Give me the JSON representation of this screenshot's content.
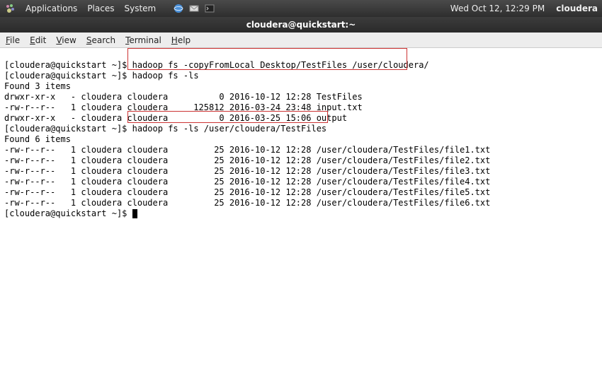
{
  "top_panel": {
    "menu": [
      "Applications",
      "Places",
      "System"
    ],
    "datetime": "Wed Oct 12, 12:29 PM",
    "user": "cloudera"
  },
  "window": {
    "title": "cloudera@quickstart:~"
  },
  "menubar": [
    "File",
    "Edit",
    "View",
    "Search",
    "Terminal",
    "Help"
  ],
  "terminal": {
    "prompt": "[cloudera@quickstart ~]$ ",
    "cmds": {
      "c1": "hadoop fs -copyFromLocal Desktop/TestFiles /user/cloudera/",
      "c2": "hadoop fs -ls",
      "c3": "hadoop fs -ls /user/cloudera/TestFiles"
    },
    "found3": "Found 3 items",
    "found6": "Found 6 items",
    "ls1": [
      "drwxr-xr-x   - cloudera cloudera          0 2016-10-12 12:28 TestFiles",
      "-rw-r--r--   1 cloudera cloudera     125812 2016-03-24 23:48 input.txt",
      "drwxr-xr-x   - cloudera cloudera          0 2016-03-25 15:06 output"
    ],
    "ls2": [
      "-rw-r--r--   1 cloudera cloudera         25 2016-10-12 12:28 /user/cloudera/TestFiles/file1.txt",
      "-rw-r--r--   1 cloudera cloudera         25 2016-10-12 12:28 /user/cloudera/TestFiles/file2.txt",
      "-rw-r--r--   1 cloudera cloudera         25 2016-10-12 12:28 /user/cloudera/TestFiles/file3.txt",
      "-rw-r--r--   1 cloudera cloudera         25 2016-10-12 12:28 /user/cloudera/TestFiles/file4.txt",
      "-rw-r--r--   1 cloudera cloudera         25 2016-10-12 12:28 /user/cloudera/TestFiles/file5.txt",
      "-rw-r--r--   1 cloudera cloudera         25 2016-10-12 12:28 /user/cloudera/TestFiles/file6.txt"
    ]
  }
}
